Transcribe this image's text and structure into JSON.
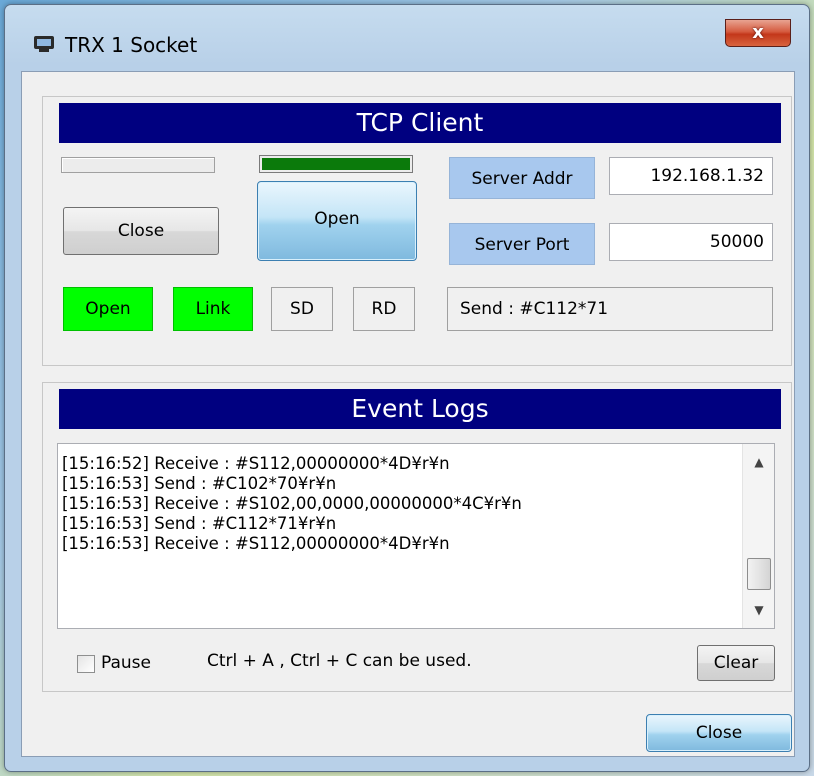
{
  "window": {
    "title": "TRX 1  Socket",
    "close_glyph": "x"
  },
  "tcp": {
    "header": "TCP Client",
    "buttons": {
      "close_label": "Close",
      "open_label": "Open"
    },
    "server_addr": {
      "label": "Server Addr",
      "value": "192.168.1.32"
    },
    "server_port": {
      "label": "Server Port",
      "value": "50000"
    },
    "indicators": {
      "open": "Open",
      "link": "Link",
      "sd": "SD",
      "rd": "RD"
    },
    "send_text": "Send : #C112*71",
    "indicator_colors": {
      "active": "#00ff00"
    },
    "progress_fill_color": "#0b7a0b"
  },
  "logs": {
    "header": "Event Logs",
    "lines": [
      "[15:16:52] Receive : #S112,00000000*4D¥r¥n",
      "[15:16:53] Send : #C102*70¥r¥n",
      "[15:16:53] Receive : #S102,00,0000,00000000*4C¥r¥n",
      "[15:16:53] Send : #C112*71¥r¥n",
      "[15:16:53] Receive : #S112,00000000*4D¥r¥n"
    ],
    "pause_label": "Pause",
    "pause_checked": false,
    "hint": "Ctrl + A , Ctrl + C  can be used.",
    "clear_label": "Clear"
  },
  "footer": {
    "close_label": "Close"
  },
  "colors": {
    "header_bg": "#000080",
    "label_bg": "#a8c8ee"
  }
}
